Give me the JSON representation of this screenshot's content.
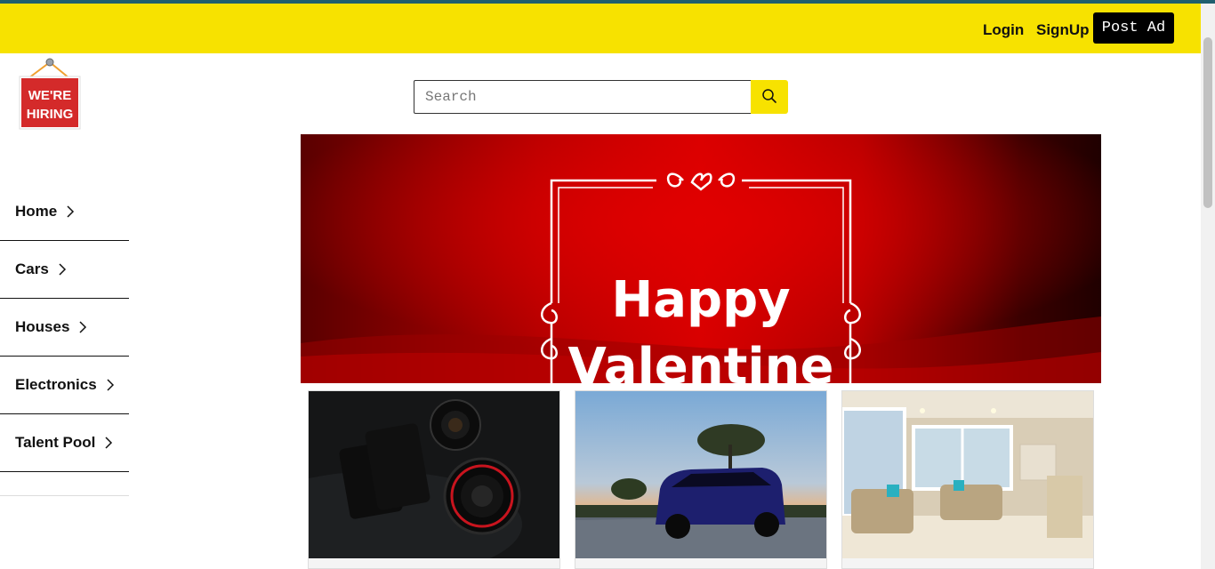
{
  "header": {
    "login_label": "Login",
    "signup_label": "SignUp",
    "post_ad_label": "Post Ad",
    "bar_color": "#f7e200"
  },
  "logo": {
    "line1": "WE'RE",
    "line2": "HIRING",
    "color": "#d42a2a"
  },
  "search": {
    "placeholder": "Search",
    "value": "",
    "icon": "search-icon"
  },
  "sidebar": {
    "items": [
      {
        "label": "Home",
        "icon": "chevron-right-icon"
      },
      {
        "label": "Cars",
        "icon": "chevron-right-icon"
      },
      {
        "label": "Houses",
        "icon": "chevron-right-icon"
      },
      {
        "label": "Electronics",
        "icon": "chevron-right-icon"
      },
      {
        "label": "Talent Pool",
        "icon": "chevron-right-icon"
      }
    ]
  },
  "banner": {
    "line1": "Happy",
    "line2": "Valentine"
  },
  "cards": [
    {
      "image": "camera-photo"
    },
    {
      "image": "car-photo"
    },
    {
      "image": "living-room-photo"
    }
  ]
}
